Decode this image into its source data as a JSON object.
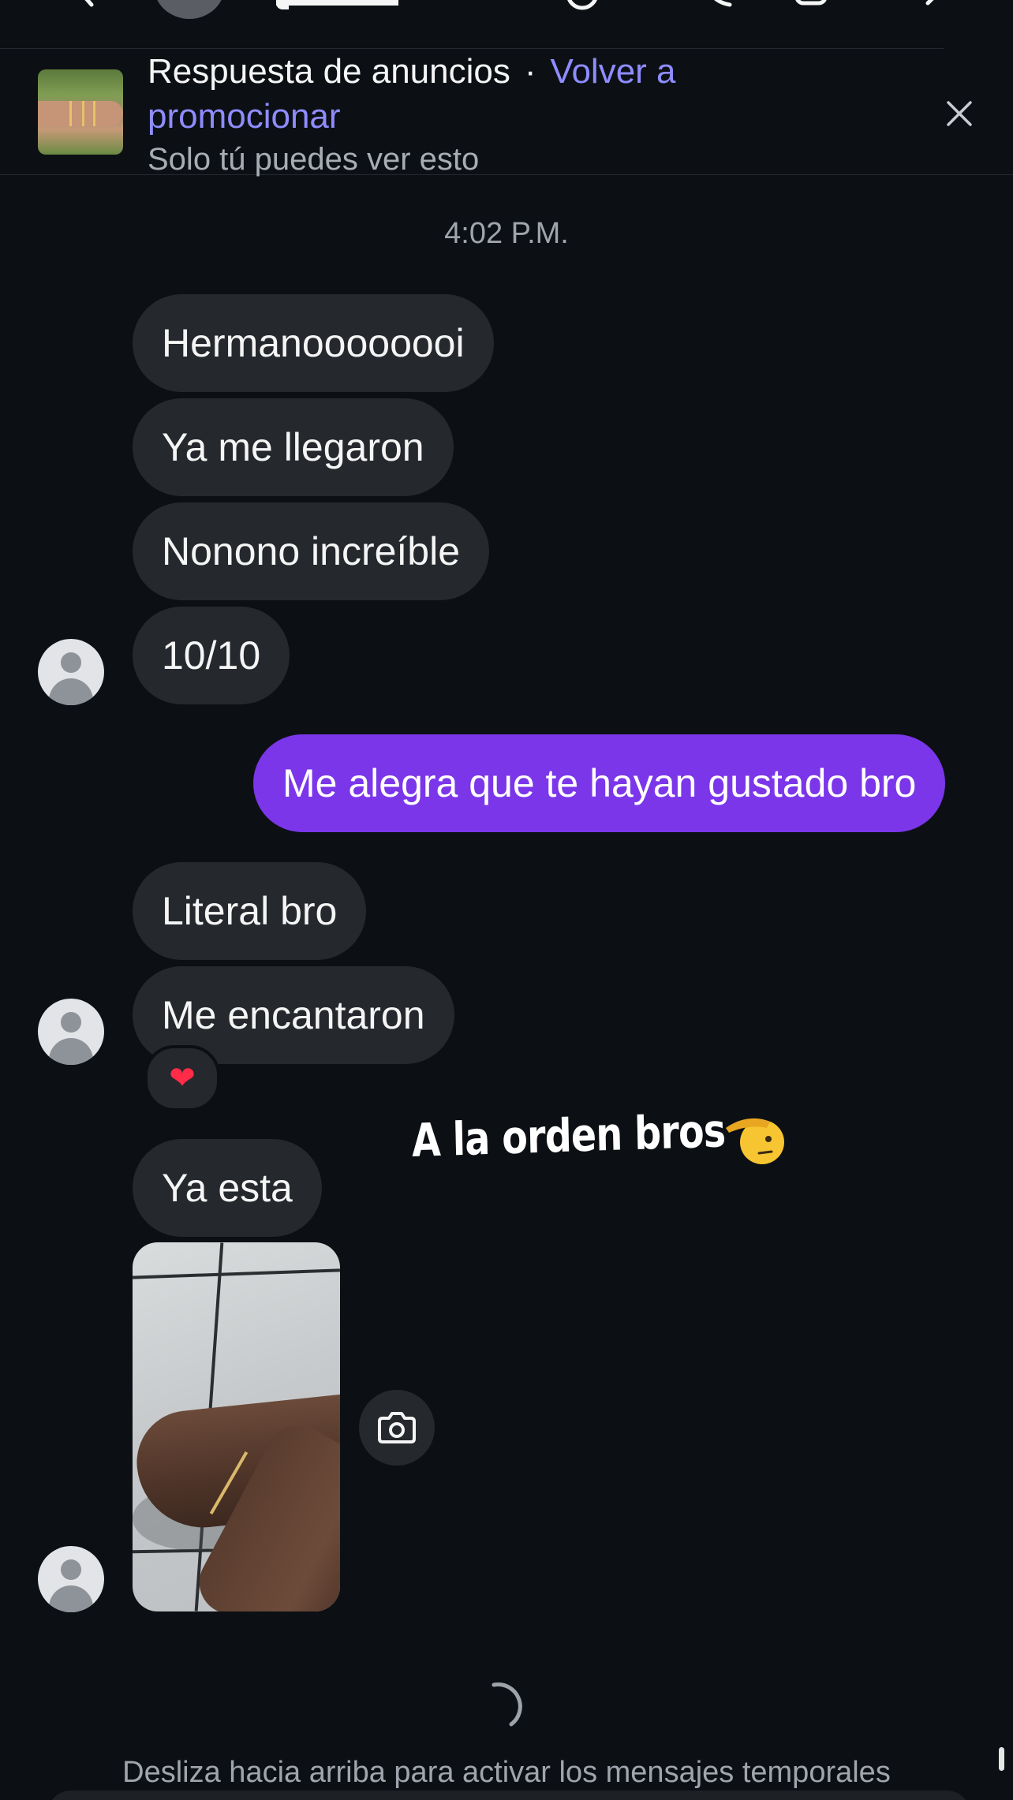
{
  "banner": {
    "title": "Respuesta de anuncios",
    "separator": "·",
    "link_line1": "Volver a",
    "link_line2": "promocionar",
    "subtitle": "Solo tú puedes ver esto"
  },
  "timestamp": "4:02 P.M.",
  "messages": {
    "m1": "Hermanoooooooi",
    "m2": "Ya me llegaron",
    "m3": "Nonono increíble",
    "m4": "10/10",
    "m5": "Me alegra que te hayan gustado bro",
    "m6": "Literal bro",
    "m7": "Me encantaron",
    "m8": "Ya esta"
  },
  "reaction": "❤",
  "sticker": {
    "text": "A la orden bros",
    "emoji": "saluting-face"
  },
  "footer": {
    "hint": "Desliza hacia arriba para activar los mensajes temporales"
  },
  "colors": {
    "background": "#0c1014",
    "incoming_bubble": "#25282d",
    "outgoing_bubble": "#7b36ea",
    "link": "#8f8cff",
    "secondary_text": "#a0a5ad"
  }
}
